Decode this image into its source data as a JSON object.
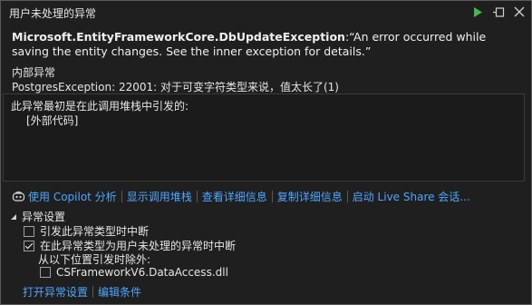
{
  "window": {
    "title": "用户未处理的异常"
  },
  "exception": {
    "type": "Microsoft.EntityFrameworkCore.DbUpdateException",
    "message": ":“An error occurred while saving the entity changes. See the inner exception for details.”",
    "inner_label": "内部异常",
    "inner_message": "PostgresException: 22001: 对于可变字符类型来说，值太长了(1)"
  },
  "stack": {
    "line1": "此异常最初是在此调用堆栈中引发的:",
    "line2": "[外部代码]"
  },
  "actions": {
    "copilot": "使用 Copilot 分析",
    "show_stack": "显示调用堆栈",
    "view_details": "查看详细信息",
    "copy_details": "复制详细信息",
    "live_share": "启动 Live Share 会话..."
  },
  "settings": {
    "header": "异常设置",
    "break_on_thrown": "引发此异常类型时中断",
    "break_unhandled": "在此异常类型为用户未处理的异常时中断",
    "except_from": "从以下位置引发时除外:",
    "dll": "CSFrameworkV6.DataAccess.dll",
    "open_settings": "打开异常设置",
    "edit_conditions": "编辑条件"
  },
  "colors": {
    "accent_link": "#4ea6ff",
    "play_green": "#3fb950",
    "background": "#1f1f1f"
  }
}
